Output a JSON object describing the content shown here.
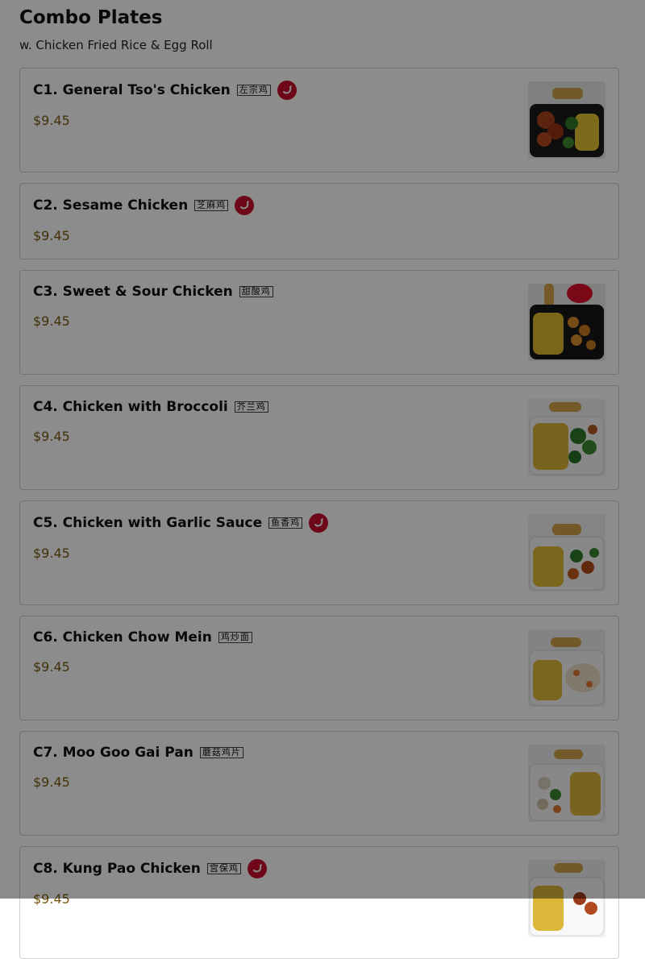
{
  "section": {
    "title": "Combo Plates",
    "subtitle": "w. Chicken Fried Rice & Egg Roll"
  },
  "items": [
    {
      "name": "C1. General Tso's Chicken",
      "chinese": "左宗鸡",
      "price": "$9.45",
      "spicy": true,
      "photo": true
    },
    {
      "name": "C2. Sesame Chicken",
      "chinese": "芝麻鸡",
      "price": "$9.45",
      "spicy": true,
      "photo": false
    },
    {
      "name": "C3. Sweet & Sour Chicken",
      "chinese": "甜酸鸡",
      "price": "$9.45",
      "spicy": false,
      "photo": true
    },
    {
      "name": "C4. Chicken with Broccoli",
      "chinese": "芥兰鸡",
      "price": "$9.45",
      "spicy": false,
      "photo": true
    },
    {
      "name": "C5. Chicken with Garlic Sauce",
      "chinese": "鱼香鸡",
      "price": "$9.45",
      "spicy": true,
      "photo": true
    },
    {
      "name": "C6. Chicken Chow Mein",
      "chinese": "鸡炒面",
      "price": "$9.45",
      "spicy": false,
      "photo": true
    },
    {
      "name": "C7. Moo Goo Gai Pan",
      "chinese": "蘑菇鸡片",
      "price": "$9.45",
      "spicy": false,
      "photo": true
    },
    {
      "name": "C8. Kung Pao Chicken",
      "chinese": "宫保鸡",
      "price": "$9.45",
      "spicy": true,
      "photo": true
    }
  ],
  "icons": {
    "spicy": "chili-pepper-icon"
  },
  "colors": {
    "price": "#7a5a12",
    "spicy": "#c8102e",
    "overlay": "rgba(0,0,0,0.45)"
  }
}
